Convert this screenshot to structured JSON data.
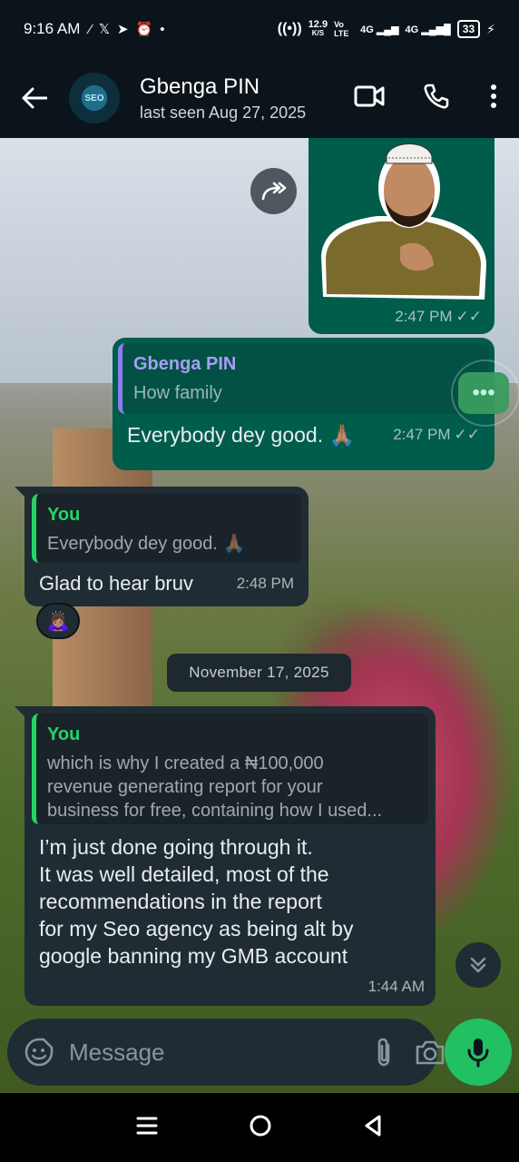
{
  "status_bar": {
    "time": "9:16 AM",
    "net_speed": "12.9",
    "net_unit": "K/S",
    "volte": "Vo LTE",
    "signal_1": "4G",
    "signal_2": "4G",
    "battery": "33"
  },
  "header": {
    "contact_name": "Gbenga PIN",
    "last_seen": "last seen Aug 27, 2025",
    "avatar_text": "SEO"
  },
  "messages": [
    {
      "type": "sticker",
      "direction": "out",
      "time": "2:47 PM",
      "status": "read"
    },
    {
      "type": "reply",
      "direction": "out",
      "quoted_author": "Gbenga PIN",
      "quoted_text": "How family",
      "text": "Everybody dey good. 🙏🏽",
      "time": "2:47 PM",
      "status": "read"
    },
    {
      "type": "reply",
      "direction": "in",
      "quoted_author": "You",
      "quoted_text": "Everybody dey good. 🙏🏽",
      "text": "Glad to hear bruv",
      "time": "2:48 PM",
      "reaction": "🙇🏽‍♀️"
    },
    {
      "type": "reply",
      "direction": "in",
      "quoted_author": "You",
      "quoted_text_lines": [
        "which is why I created a ₦100,000",
        "revenue generating report for your",
        "business for free, containing how I used..."
      ],
      "text_lines": [
        "I’m just done going through it.",
        "It was well detailed, most of the",
        "recommendations in the report",
        "for my Seo agency as being alt by",
        "google banning my GMB account"
      ],
      "time": "1:44 AM"
    }
  ],
  "date_separator": "November 17, 2025",
  "composer": {
    "placeholder": "Message"
  },
  "colors": {
    "outgoing_bubble": "#005c4b",
    "incoming_bubble": "#202c33",
    "accent_green": "#25d366",
    "mic_button": "#21c063",
    "header_bg": "#0b141a"
  },
  "icons": {
    "back": "back-arrow-icon",
    "video": "video-call-icon",
    "phone": "voice-call-icon",
    "menu": "more-options-icon",
    "forward": "forward-icon",
    "emoji": "sticker-emoji-icon",
    "attach": "attach-icon",
    "camera": "camera-icon",
    "mic": "mic-icon",
    "scroll": "scroll-down-icon"
  }
}
